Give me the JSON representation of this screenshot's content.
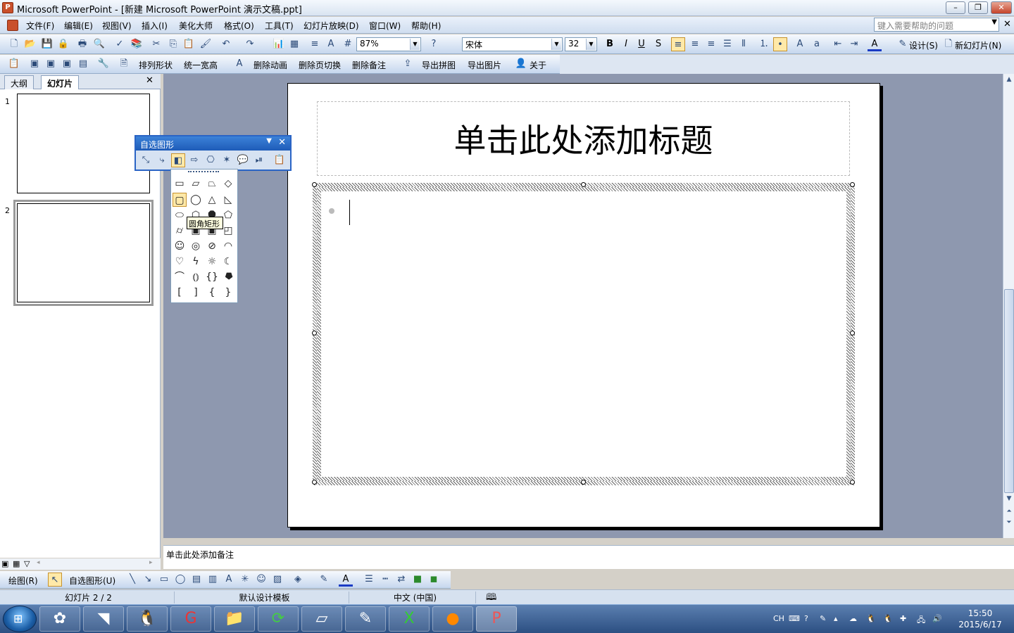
{
  "window": {
    "title": "Microsoft PowerPoint - [新建 Microsoft PowerPoint 演示文稿.ppt]",
    "app_icon": "P"
  },
  "menubar": {
    "items": [
      "文件(F)",
      "编辑(E)",
      "视图(V)",
      "插入(I)",
      "美化大师",
      "格式(O)",
      "工具(T)",
      "幻灯片放映(D)",
      "窗口(W)",
      "帮助(H)"
    ],
    "help_placeholder": "键入需要帮助的问题"
  },
  "toolbar1": {
    "zoom": "87%",
    "font": "宋体",
    "size": "32",
    "design": "设计(S)",
    "new_slide": "新幻灯片(N)"
  },
  "toolbar2": {
    "items": [
      "排列形状",
      "统一宽高",
      "删除动画",
      "删除页切换",
      "删除备注",
      "导出拼图",
      "导出图片",
      "关于"
    ]
  },
  "leftpane": {
    "tab_outline": "大纲",
    "tab_slides": "幻灯片",
    "slide1": "1",
    "slide2": "2"
  },
  "slide": {
    "title": "单击此处添加标题"
  },
  "notes": {
    "placeholder": "单击此处添加备注"
  },
  "autoshape": {
    "title": "自选图形",
    "tooltip": "圆角矩形"
  },
  "drawtb": {
    "draw": "绘图(R)",
    "autoshapes": "自选图形(U)"
  },
  "status": {
    "slide": "幻灯片 2 / 2",
    "template": "默认设计模板",
    "lang": "中文 (中国)"
  },
  "tray": {
    "ime": "CH",
    "time": "15:50",
    "date": "2015/6/17"
  }
}
